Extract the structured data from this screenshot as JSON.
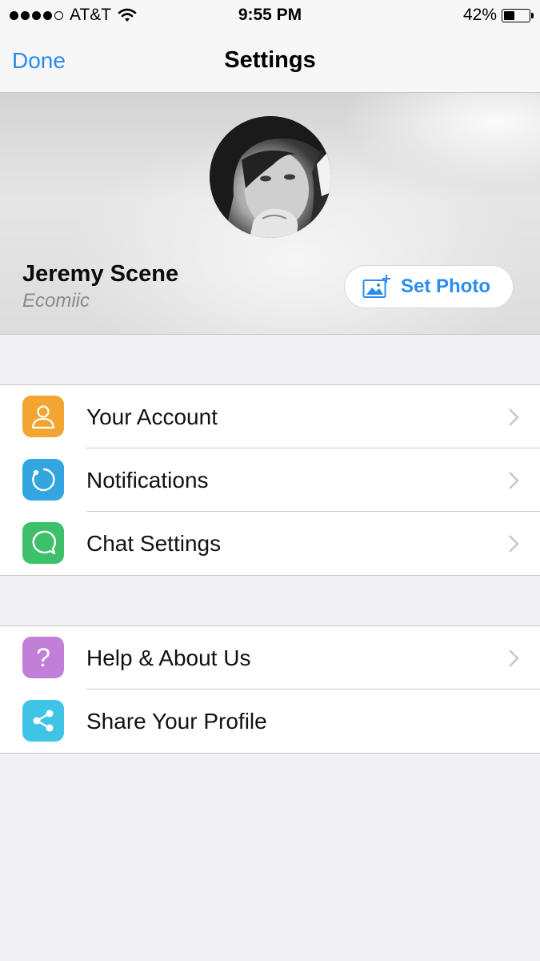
{
  "status_bar": {
    "carrier": "AT&T",
    "signal_bars_filled": 4,
    "signal_bars_total": 5,
    "time": "9:55 PM",
    "battery_text": "42%",
    "battery_level": 0.42
  },
  "nav": {
    "done_label": "Done",
    "title": "Settings"
  },
  "profile": {
    "name": "Jeremy Scene",
    "subtitle": "Ecomiic",
    "set_photo_label": "Set Photo"
  },
  "menu_group_1": [
    {
      "label": "Your Account",
      "icon": "person-icon",
      "color": "#f2a531",
      "chevron": true
    },
    {
      "label": "Notifications",
      "icon": "notification-ring-icon",
      "color": "#33a6e0",
      "chevron": true
    },
    {
      "label": "Chat Settings",
      "icon": "chat-bubble-icon",
      "color": "#3cc16a",
      "chevron": true
    }
  ],
  "menu_group_2": [
    {
      "label": "Help & About Us",
      "icon": "question-mark-icon",
      "color": "#c17fd8",
      "chevron": true
    },
    {
      "label": "Share Your Profile",
      "icon": "share-icon",
      "color": "#3fc4e6",
      "chevron": false
    }
  ],
  "colors": {
    "accent": "#2a8cf0",
    "background": "#efeff4",
    "separator": "#c8c7cc"
  }
}
